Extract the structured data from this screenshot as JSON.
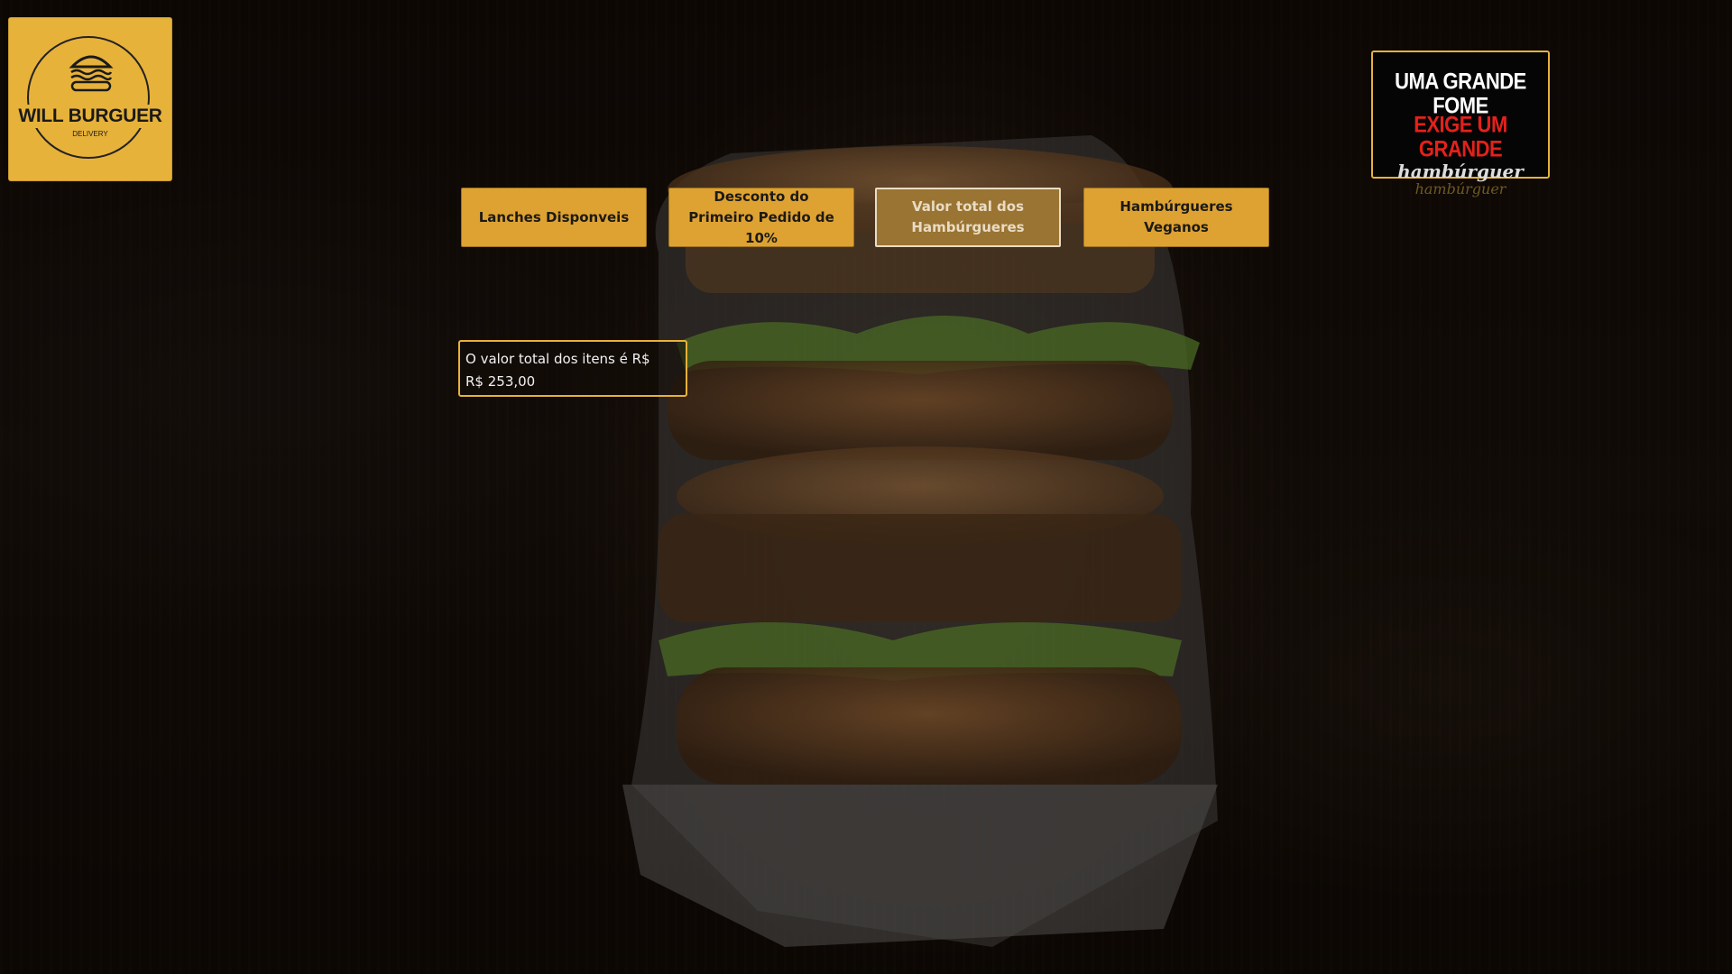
{
  "logo_left": {
    "brand": "WILL BURGUER",
    "subtitle": "DELIVERY"
  },
  "logo_right": {
    "line1": "UMA GRANDE FOME",
    "line2": "EXIGE UM GRANDE",
    "line3": "hambúrguer",
    "line4": "hambúrguer"
  },
  "nav": {
    "buttons": [
      {
        "label": "Lanches Disponveis",
        "active": false
      },
      {
        "label": "Desconto do Primeiro Pedido de 10%",
        "active": false
      },
      {
        "label": "Valor total dos Hambúrgueres",
        "active": true
      },
      {
        "label": "Hambúrgueres Veganos",
        "active": false
      }
    ]
  },
  "result": {
    "line1": "O valor total dos itens é R$",
    "line2": "R$ 253,00"
  },
  "colors": {
    "accent": "#dea232",
    "active_button": "#9a7433",
    "brand_red": "#e4211b",
    "background": "#120b07"
  }
}
